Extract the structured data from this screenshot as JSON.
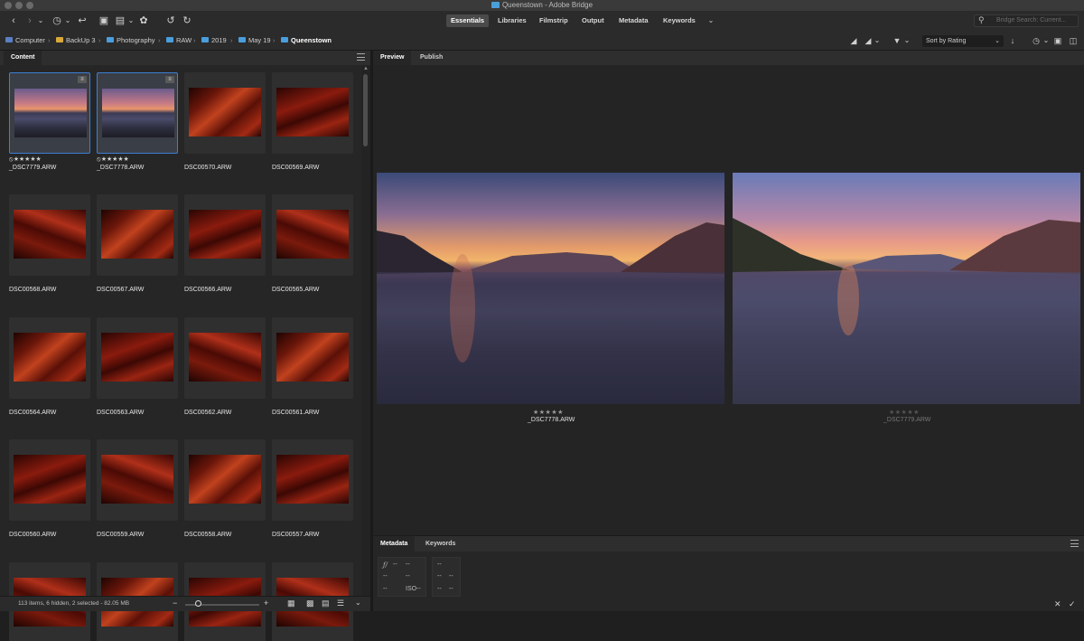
{
  "window": {
    "title": "Queenstown - Adobe Bridge"
  },
  "toolbar": {
    "workspaces": [
      "Essentials",
      "Libraries",
      "Filmstrip",
      "Output",
      "Metadata",
      "Keywords"
    ],
    "active_workspace": "Essentials",
    "search_placeholder": "Bridge Search: Current..."
  },
  "path": {
    "crumbs": [
      "Computer",
      "BackUp 3",
      "Photography",
      "RAW",
      "2019",
      "May 19",
      "Queenstown"
    ],
    "sort_label": "Sort by Rating"
  },
  "content_panel": {
    "tab": "Content",
    "items": [
      {
        "name": "_DSC7779.ARW",
        "rating": "⦸★★★★★",
        "kind": "lake",
        "selected": true
      },
      {
        "name": "_DSC7778.ARW",
        "rating": "⦸★★★★★",
        "kind": "lake",
        "selected": true
      },
      {
        "name": "DSC00570.ARW",
        "rating": "",
        "kind": "red"
      },
      {
        "name": "DSC00569.ARW",
        "rating": "",
        "kind": "red"
      },
      {
        "name": "DSC00568.ARW",
        "rating": "",
        "kind": "red"
      },
      {
        "name": "DSC00567.ARW",
        "rating": "",
        "kind": "red"
      },
      {
        "name": "DSC00566.ARW",
        "rating": "",
        "kind": "red"
      },
      {
        "name": "DSC00565.ARW",
        "rating": "",
        "kind": "red"
      },
      {
        "name": "DSC00564.ARW",
        "rating": "",
        "kind": "red"
      },
      {
        "name": "DSC00563.ARW",
        "rating": "",
        "kind": "red"
      },
      {
        "name": "DSC00562.ARW",
        "rating": "",
        "kind": "red"
      },
      {
        "name": "DSC00561.ARW",
        "rating": "",
        "kind": "red"
      },
      {
        "name": "DSC00560.ARW",
        "rating": "",
        "kind": "red"
      },
      {
        "name": "DSC00559.ARW",
        "rating": "",
        "kind": "red"
      },
      {
        "name": "DSC00558.ARW",
        "rating": "",
        "kind": "red"
      },
      {
        "name": "DSC00557.ARW",
        "rating": "",
        "kind": "red"
      },
      {
        "name": "",
        "rating": "",
        "kind": "red"
      },
      {
        "name": "",
        "rating": "",
        "kind": "red"
      },
      {
        "name": "",
        "rating": "",
        "kind": "red"
      },
      {
        "name": "",
        "rating": "",
        "kind": "red"
      }
    ],
    "status": "113 items, 6 hidden, 2 selected - 82.05 MB"
  },
  "preview_panel": {
    "tabs": [
      "Preview",
      "Publish"
    ],
    "active_tab": "Preview",
    "images": [
      {
        "name": "_DSC7778.ARW",
        "rating": "★★★★★",
        "dim": false
      },
      {
        "name": "_DSC7779.ARW",
        "rating": "★★★★★",
        "dim": true
      }
    ]
  },
  "metadata_panel": {
    "tabs": [
      "Metadata",
      "Keywords"
    ],
    "active_tab": "Metadata",
    "fnumber_symbol": "ƒ/",
    "cells": [
      "--",
      "--",
      "--",
      "--",
      "--",
      "--",
      "ISO--",
      "--",
      "--",
      "--",
      "--"
    ]
  },
  "colors": {
    "accent": "#3c7fd4",
    "folder": "#4a9edc",
    "drive": "#d9a93a"
  }
}
